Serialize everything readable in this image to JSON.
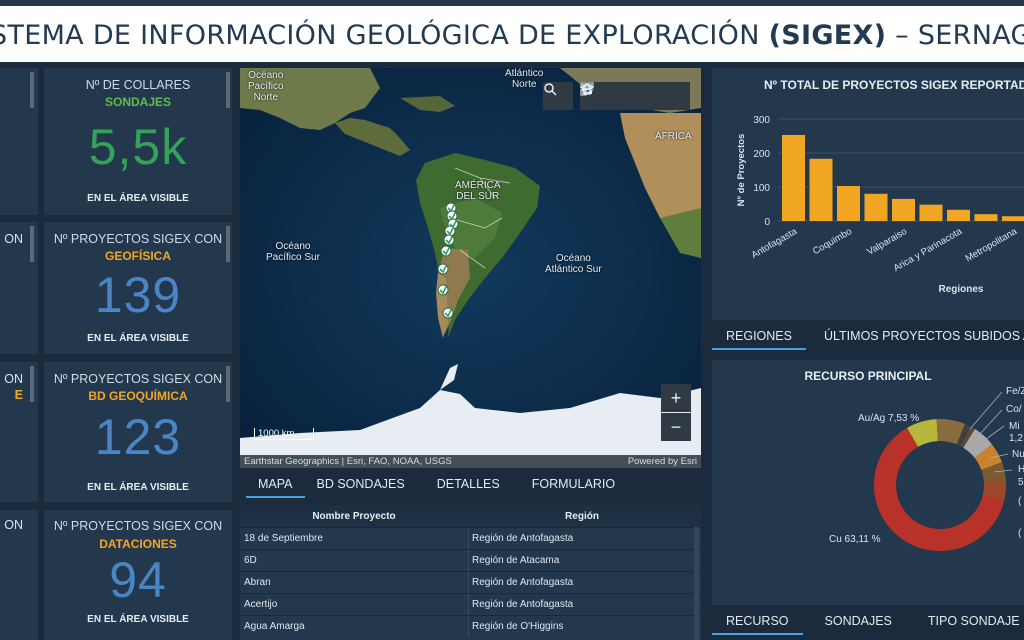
{
  "header": {
    "title_prefix": "STEMA DE INFORMACIÓN GEOLÓGICA DE EXPLORACIÓN ",
    "title_bold": "(SIGEX)",
    "title_suffix": " – SERNAGEOMIN"
  },
  "stats": [
    {
      "label": "Nº DE COLLARES",
      "sub": "SONDAJES",
      "sub_color": "#5bbf4a",
      "value": "5,5k",
      "value_color": "#35a25a",
      "foot": "EN EL ÁREA VISIBLE"
    },
    {
      "label": "Nº PROYECTOS SIGEX CON",
      "sub": "GEOFÍSICA",
      "sub_color": "#f2a623",
      "value": "139",
      "value_color": "#4a86c5",
      "foot": "EN EL ÁREA VISIBLE"
    },
    {
      "label": "Nº PROYECTOS SIGEX CON",
      "sub": "BD GEOQUÍMICA",
      "sub_color": "#f2a623",
      "value": "123",
      "value_color": "#4a86c5",
      "foot": "EN EL ÁREA VISIBLE"
    },
    {
      "label": "Nº PROYECTOS SIGEX CON",
      "sub": "DATACIONES",
      "sub_color": "#f2a623",
      "value": "94",
      "value_color": "#4a86c5",
      "foot": "EN EL ÁREA VISIBLE"
    }
  ],
  "left_partial": [
    {
      "text": "ON",
      "color": "#cfdbe6"
    },
    {
      "text": "ON",
      "color": "#cfdbe6"
    },
    {
      "text": "E",
      "color": "#f2a623"
    },
    {
      "text": "ON",
      "color": "#cfdbe6"
    }
  ],
  "map": {
    "labels": {
      "pac_norte": "Océano\nPacífico\nNorte",
      "atl_norte": "Atlántico\nNorte",
      "africa": "ÁFRICA",
      "america": "AMÉRICA\nDEL SUR",
      "pac_sur": "Océano\nPacífico Sur",
      "atl_sur": "Océano\nAtlántico Sur"
    },
    "scale": "1000 km",
    "attribution": "Earthstar Geographics | Esri, FAO, NOAA, USGS",
    "powered": "Powered by Esri",
    "icons": [
      "search-icon",
      "home-icon",
      "list-icon",
      "layers-icon",
      "qr-icon"
    ],
    "zoom_in": "+",
    "zoom_out": "−"
  },
  "center_tabs": [
    "MAPA",
    "BD SONDAJES",
    "DETALLES",
    "FORMULARIO"
  ],
  "table": {
    "headers": [
      "Nombre Proyecto",
      "Región"
    ],
    "rows": [
      [
        "18 de Septiembre",
        "Región de Antofagasta"
      ],
      [
        "6D",
        "Región de Atacama"
      ],
      [
        "Abran",
        "Región de Antofagasta"
      ],
      [
        "Acertijo",
        "Región de Antofagasta"
      ],
      [
        "Agua Amarga",
        "Región de O'Higgins"
      ]
    ]
  },
  "bar_panel": {
    "title": "Nº TOTAL DE PROYECTOS SIGEX REPORTADOS"
  },
  "chart_data": [
    {
      "type": "bar",
      "title": "Nº TOTAL DE PROYECTOS SIGEX REPORTADOS",
      "xlabel": "Regiones",
      "ylabel": "Nº de Proyectos",
      "ylim": [
        0,
        300
      ],
      "yticks": [
        0,
        100,
        200,
        300
      ],
      "categories": [
        "Antofagasta",
        "",
        "Coquimbo",
        "",
        "Valparaiso",
        "",
        "Arica y Parinacota",
        "",
        "Metropolitana",
        ""
      ],
      "values": [
        253,
        183,
        103,
        80,
        65,
        48,
        33,
        20,
        14,
        11
      ],
      "color": "#f0a623",
      "grid": true
    },
    {
      "type": "pie",
      "title": "RECURSO PRINCIPAL",
      "labels": [
        "Cu",
        "Au/Ag",
        "Fe/Z",
        "Co/",
        "Mi",
        "Nu",
        "H",
        "",
        ""
      ],
      "visible_label_text": [
        "Cu 63,11 %",
        "Au/Ag 7,53 %",
        "Fe/Z",
        "Co/",
        "Mir",
        "1,2",
        "Nu",
        "H",
        "5",
        "(",
        "("
      ],
      "values": [
        63.11,
        7.53,
        7.0,
        1.5,
        1.2,
        5.5,
        5.0,
        4.5,
        4.66
      ],
      "colors": [
        "#b8322a",
        "#b7b83a",
        "#8a6d3f",
        "#3f3f3f",
        "#5a4a3a",
        "#a9a9a9",
        "#c9822f",
        "#7e5a33",
        "#9c4a2c"
      ]
    }
  ],
  "bar_tabs": [
    "REGIONES",
    "ÚLTIMOS PROYECTOS SUBIDOS A"
  ],
  "pie_panel": {
    "title": "RECURSO PRINCIPAL",
    "label_cu": "Cu 63,11 %",
    "label_au": "Au/Ag 7,53 %",
    "label_fe": "Fe/Z",
    "label_co": "Co/",
    "label_mi": "Mi",
    "label_mi2": "1,2",
    "label_nu": "Nu",
    "label_h": "H",
    "label_h2": "5",
    "label_p1": "(",
    "label_p2": "("
  },
  "bottom_tabs": [
    "RECURSO",
    "SONDAJES",
    "TIPO SONDAJE"
  ]
}
